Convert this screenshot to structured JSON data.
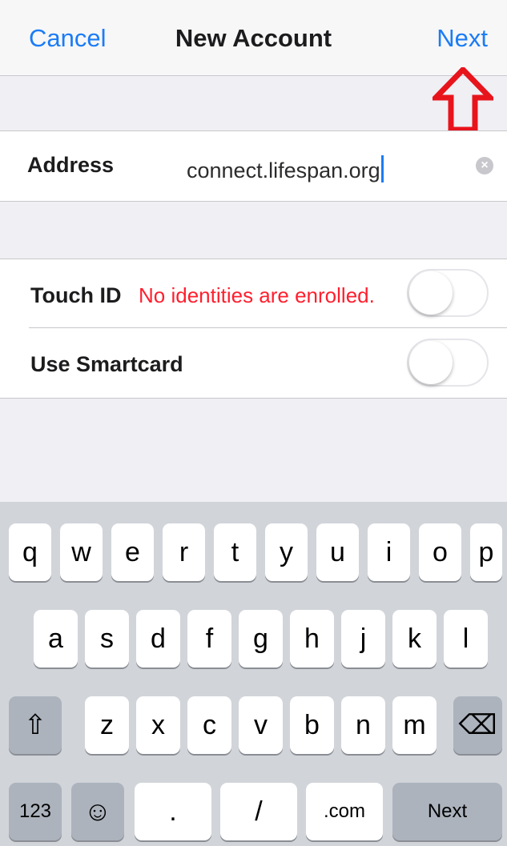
{
  "navbar": {
    "cancel": "Cancel",
    "title": "New Account",
    "next": "Next"
  },
  "address": {
    "label": "Address",
    "value": "connect.lifespan.org"
  },
  "touch_id": {
    "label": "Touch ID",
    "error": "No identities are enrolled.",
    "on": false
  },
  "smartcard": {
    "label": "Use Smartcard",
    "on": false
  },
  "keyboard": {
    "row1": [
      "q",
      "w",
      "e",
      "r",
      "t",
      "y",
      "u",
      "i",
      "o",
      "p"
    ],
    "row2": [
      "a",
      "s",
      "d",
      "f",
      "g",
      "h",
      "j",
      "k",
      "l"
    ],
    "row3": [
      "z",
      "x",
      "c",
      "v",
      "b",
      "n",
      "m"
    ],
    "numbers": "123",
    "emoji": "☺",
    "dot": ".",
    "slash": "/",
    "dotcom": ".com",
    "next": "Next",
    "shift": "⇧",
    "backspace": "⌫"
  },
  "colors": {
    "accent": "#1b7cf6",
    "error": "#ff1f2e",
    "annotation": "#e8141c"
  }
}
